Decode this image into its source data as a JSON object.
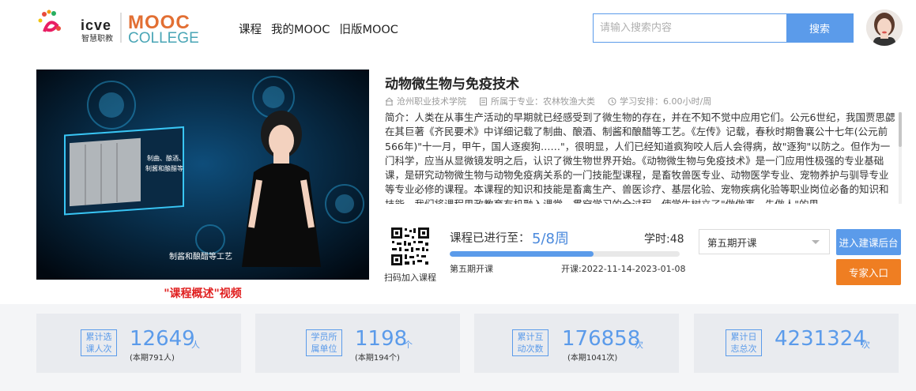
{
  "header": {
    "logo_brand": "icve",
    "logo_brand_sub": "智慧职教",
    "logo_mooc": "MOOC",
    "logo_college": "COLLEGE",
    "nav": [
      "课程",
      "我的MOOC",
      "旧版MOOC"
    ],
    "search_placeholder": "请输入搜索内容",
    "search_button": "搜索"
  },
  "video": {
    "overlay_title": "制酱和酿醋等工艺",
    "inset_text_1": "制曲、酿酒、",
    "inset_text_2": "制酱和酿醋等",
    "caption": "\"课程概述\"视频"
  },
  "course": {
    "title": "动物微生物与免疫技术",
    "school": "沧州职业技术学院",
    "major": "所属于专业：农林牧渔大类",
    "schedule": "学习安排：6.00小时/周",
    "description": "简介：人类在从事生产活动的早期就已经感受到了微生物的存在，并在不知不觉中应用它们。公元6世纪，我国贾思勰在其巨著《齐民要术》中详细记载了制曲、酿酒、制酱和酿醋等工艺。《左传》记载，春秋时期鲁襄公十七年(公元前566年)\"十一月，甲午，国人逐瘈狗……\"，很明显，人们已经知道疯狗咬人后人会得病，故\"逐狗\"以防之。但作为一门科学，应当从显微镜发明之后，认识了微生物世界开始。《动物微生物与免疫技术》是一门应用性极强的专业基础课，是研究动物微生物与动物免疫病关系的一门技能型课程，是畜牧兽医专业、动物医学专业、宠物养护与驯导专业等专业必修的课程。本课程的知识和技能是畜禽生产、兽医诊疗、基层化验、宠物疾病化验等职业岗位必备的知识和技能。我们将课程思政教育有机融入课堂，贯穿学习的全过程，使学生树立了\"做做事，先做人\"的思"
  },
  "progress": {
    "qr_label": "扫码加入课程",
    "label": "课程已进行至：",
    "value": "5/8周",
    "fraction": 0.625,
    "hours": "学时:48",
    "term": "第五期开课",
    "dates": "开课:2022-11-14-2023-01-08"
  },
  "actions": {
    "select_value": "第五期开课",
    "enter_button": "进入建课后台",
    "expert_button": "专家入口"
  },
  "stats": [
    {
      "label_1": "累计选",
      "label_2": "课人次",
      "value": "12649",
      "unit": "人",
      "sub": "(本期791人)"
    },
    {
      "label_1": "学员所",
      "label_2": "属单位",
      "value": "1198",
      "unit": "个",
      "sub": "(本期194个)"
    },
    {
      "label_1": "累计互",
      "label_2": "动次数",
      "value": "176858",
      "unit": "次",
      "sub": "(本期1041次)"
    },
    {
      "label_1": "累计日",
      "label_2": "志总次",
      "value": "4231324",
      "unit": "次",
      "sub": ""
    }
  ],
  "colors": {
    "accent": "#5b9bea",
    "orange": "#ef7e22",
    "caption_red": "#e02020"
  }
}
